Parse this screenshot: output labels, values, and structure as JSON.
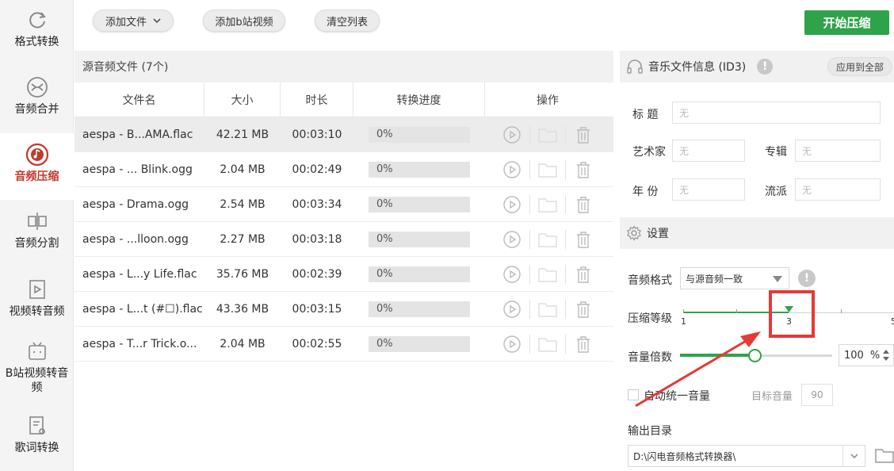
{
  "sidebar": {
    "items": [
      {
        "label": "格式转换",
        "icon": "refresh-icon"
      },
      {
        "label": "音频合并",
        "icon": "merge-icon"
      },
      {
        "label": "音频压缩",
        "icon": "compress-icon",
        "active": true
      },
      {
        "label": "音频分割",
        "icon": "split-icon"
      },
      {
        "label": "视频转音频",
        "icon": "video-icon"
      },
      {
        "label": "B站视频转音频",
        "icon": "bilibili-icon"
      },
      {
        "label": "歌词转换",
        "icon": "lyrics-icon"
      }
    ]
  },
  "toolbar": {
    "add_file": "添加文件",
    "add_bilibili": "添加b站视频",
    "clear_list": "清空列表",
    "start": "开始压缩"
  },
  "file_panel": {
    "title": "源音频文件 (7个)",
    "columns": [
      "文件名",
      "大小",
      "时长",
      "转换进度",
      "操作"
    ],
    "rows": [
      {
        "name": "aespa - B...AMA.flac",
        "size": "42.21 MB",
        "duration": "00:03:10",
        "progress": "0%"
      },
      {
        "name": "aespa - ... Blink.ogg",
        "size": "2.04 MB",
        "duration": "00:02:49",
        "progress": "0%"
      },
      {
        "name": "aespa - Drama.ogg",
        "size": "2.54 MB",
        "duration": "00:03:34",
        "progress": "0%"
      },
      {
        "name": "aespa - ...lloon.ogg",
        "size": "2.27 MB",
        "duration": "00:03:18",
        "progress": "0%"
      },
      {
        "name": "aespa - L...y Life.flac",
        "size": "35.76 MB",
        "duration": "00:02:39",
        "progress": "0%"
      },
      {
        "name": "aespa - L...t (#☐).flac",
        "size": "43.36 MB",
        "duration": "00:03:15",
        "progress": "0%"
      },
      {
        "name": "aespa - T...r Trick.o...",
        "size": "2.04 MB",
        "duration": "00:02:55",
        "progress": "0%"
      }
    ]
  },
  "music_info": {
    "title": "音乐文件信息 (ID3)",
    "apply_all": "应用到全部",
    "title_label": "标 题",
    "artist_label": "艺术家",
    "album_label": "专辑",
    "year_label": "年 份",
    "genre_label": "流派",
    "placeholder": "无"
  },
  "settings": {
    "title": "设置",
    "format_label": "音频格式",
    "format_value": "与源音频一致",
    "level_label": "压缩等级",
    "level_min": "1",
    "level_value": "3",
    "level_max": "5",
    "volume_label": "音量倍数",
    "volume_value": "100",
    "volume_unit": "%",
    "auto_volume_label": "自动统一音量",
    "target_volume_label": "目标音量",
    "target_volume_value": "90",
    "output_label": "输出目录",
    "output_path": "D:\\闪电音频格式转换器\\"
  },
  "colors": {
    "accent_green": "#2fa34a",
    "active_red": "#c0392b",
    "annotation_red": "#e53935"
  }
}
